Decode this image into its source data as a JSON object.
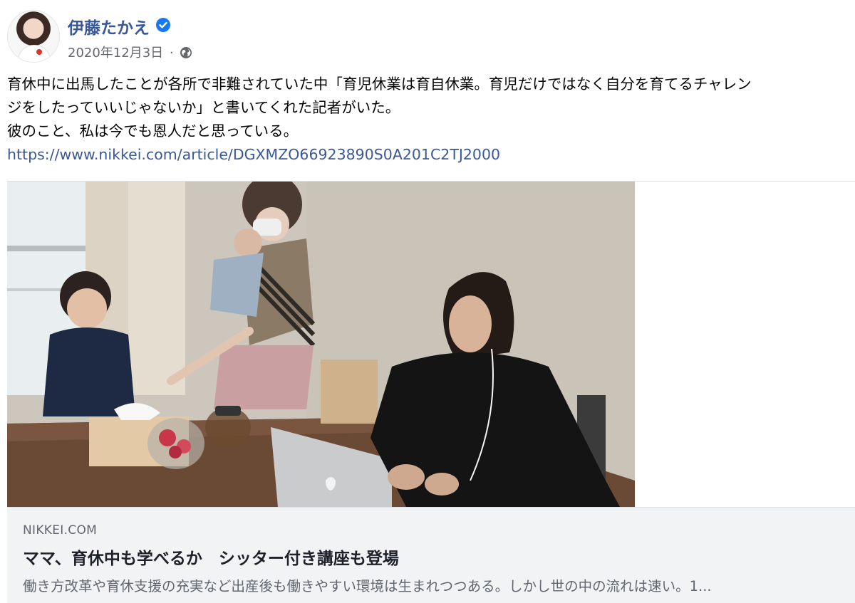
{
  "post": {
    "author": "伊藤たかえ",
    "date": "2020年12月3日",
    "separator": "·",
    "text_lines": [
      "育休中に出馬したことが各所で非難されていた中「育児休業は育自休業。育児だけではなく自分を育てるチャレン",
      "ジをしたっていいじゃないか」と書いてくれた記者がいた。",
      "彼のこと、私は今でも恩人だと思っている。"
    ],
    "link": "https://www.nikkei.com/article/DGXMZO66923890S0A201C2TJ2000"
  },
  "link_card": {
    "domain": "NIKKEI.COM",
    "title": "ママ、育休中も学べるか　シッター付き講座も登場",
    "description": "働き方改革や育休支援の充実など出産後も働きやすい環境は生まれつつある。しかし世の中の流れは速い。1..."
  },
  "icons": {
    "verified": "verified-badge-icon",
    "audience": "globe-icon"
  },
  "colors": {
    "name_blue": "#385898",
    "verified_blue": "#1877f2",
    "meta_gray": "#65676b",
    "card_bg": "#f2f3f5"
  }
}
